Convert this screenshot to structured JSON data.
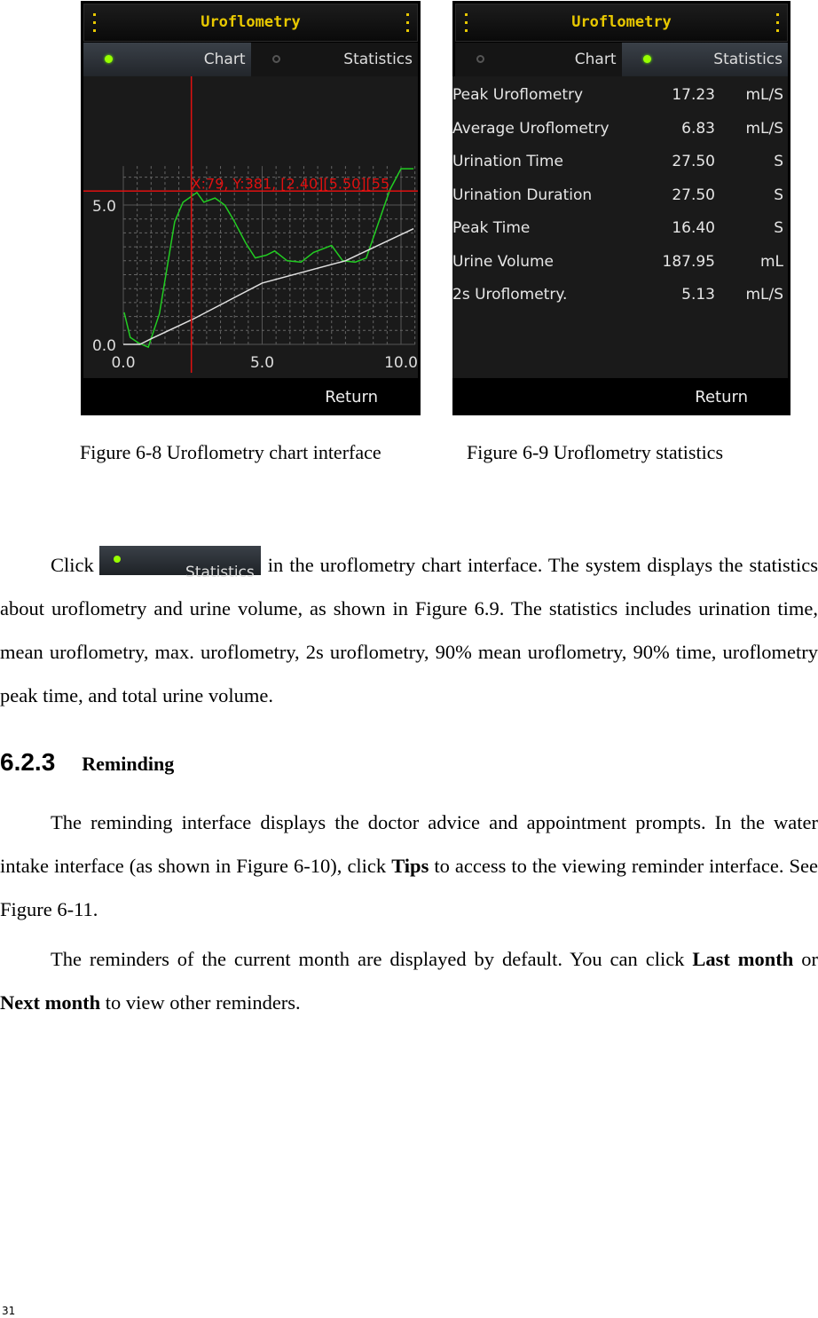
{
  "figure_left": {
    "title": "Uroflometry",
    "tabs": [
      {
        "label": "Chart",
        "active": true
      },
      {
        "label": "Statistics",
        "active": false
      }
    ],
    "return_label": "Return",
    "caption": "Figure 6-8 Uroflometry chart interface"
  },
  "figure_right": {
    "title": "Uroflometry",
    "tabs": [
      {
        "label": "Chart",
        "active": false
      },
      {
        "label": "Statistics",
        "active": true
      }
    ],
    "stats": [
      {
        "name": "Peak Uroflometry",
        "value": "17.23",
        "unit": "mL/S"
      },
      {
        "name": "Average Uroflometry",
        "value": "6.83",
        "unit": "mL/S"
      },
      {
        "name": "Urination Time",
        "value": "27.50",
        "unit": "S"
      },
      {
        "name": "Urination Duration",
        "value": "27.50",
        "unit": "S"
      },
      {
        "name": "Peak Time",
        "value": "16.40",
        "unit": "S"
      },
      {
        "name": "Urine Volume",
        "value": "187.95",
        "unit": "mL"
      },
      {
        "name": "2s Uroflometry.",
        "value": "5.13",
        "unit": "mL/S"
      }
    ],
    "return_label": "Return",
    "caption": "Figure 6-9 Uroflometry statistics"
  },
  "chart_data": {
    "type": "line",
    "title": "",
    "xlabel": "",
    "ylabel": "",
    "xlim": [
      0,
      10.5
    ],
    "ylim": [
      0,
      6.3
    ],
    "x_ticks": [
      "0.0",
      "5.0",
      "10.0"
    ],
    "y_ticks": [
      "0.0",
      "5.0"
    ],
    "grid": true,
    "colors": {
      "flow": "#22cc22",
      "volume": "#e0e0e0",
      "cursor": "#e01010",
      "background": "#1a1a1a"
    },
    "series": [
      {
        "points": [
          [
            0.03,
            1.15
          ],
          [
            0.25,
            0.25
          ],
          [
            0.55,
            0.05
          ],
          [
            0.9,
            -0.1
          ],
          [
            1.3,
            1.1
          ],
          [
            1.85,
            4.4
          ],
          [
            2.15,
            5.1
          ],
          [
            2.65,
            5.45
          ],
          [
            2.9,
            5.1
          ],
          [
            3.3,
            5.25
          ],
          [
            3.65,
            5.0
          ],
          [
            3.95,
            4.5
          ],
          [
            4.4,
            3.65
          ],
          [
            4.75,
            3.1
          ],
          [
            5.15,
            3.2
          ],
          [
            5.45,
            3.35
          ],
          [
            5.9,
            3.0
          ],
          [
            6.4,
            2.95
          ],
          [
            6.85,
            3.3
          ],
          [
            7.5,
            3.55
          ],
          [
            7.9,
            3.0
          ],
          [
            8.35,
            2.95
          ],
          [
            8.75,
            3.1
          ],
          [
            9.6,
            5.55
          ],
          [
            10.0,
            6.3
          ],
          [
            10.45,
            6.3
          ]
        ]
      },
      {
        "points": [
          [
            0,
            0
          ],
          [
            0.6,
            0
          ],
          [
            1.0,
            0.2
          ],
          [
            2.5,
            0.9
          ],
          [
            5.0,
            2.2
          ],
          [
            8.0,
            3.0
          ],
          [
            10.45,
            4.15
          ]
        ]
      }
    ],
    "cursor": {
      "x": 2.45,
      "y": 5.5,
      "label": "X:79, Y:381, [2.40][5.50][55"
    }
  },
  "body": {
    "p1_before": "Click",
    "p1_button": "Statistics",
    "p1_after": "in the uroflometry chart interface. The system displays the statistics about uroflometry and urine volume, as shown in Figure 6.9. The statistics includes urination time, mean uroflometry, max. uroflometry, 2s uroflometry, 90% mean uroflometry, 90% time, uroflometry peak time, and total urine volume.",
    "section_number": "6.2.3",
    "section_title": "Reminding",
    "p2_a": "The reminding interface displays the doctor advice and appointment prompts. In the water intake interface (as shown in Figure 6-10), click ",
    "p2_b": "Tips",
    "p2_c": " to access to the viewing reminder interface. See Figure 6-11.",
    "p3_a": "The reminders of the current month are displayed by default. You can click ",
    "p3_b": "Last month",
    "p3_c": " or ",
    "p3_d": "Next month",
    "p3_e": " to view other reminders."
  },
  "page_number": "31"
}
